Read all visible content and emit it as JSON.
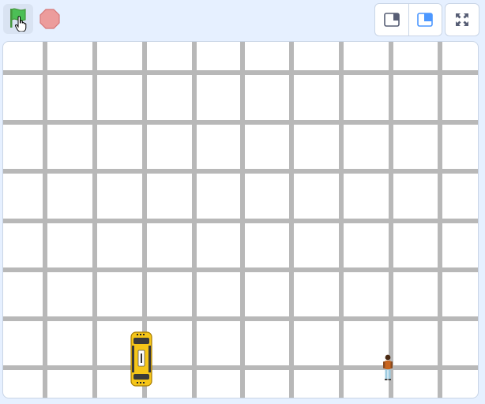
{
  "toolbar": {
    "green_flag": {
      "icon": "green-flag-icon",
      "color": "#4cbf56",
      "active": true
    },
    "stop": {
      "icon": "stop-sign-icon",
      "color": "#ec9c9c"
    },
    "layout_small_stage": {
      "icon": "small-stage-layout-icon"
    },
    "layout_normal_stage": {
      "icon": "normal-stage-layout-icon",
      "selected": true,
      "accent": "#4c97ff"
    },
    "fullscreen": {
      "icon": "fullscreen-icon"
    }
  },
  "stage": {
    "background_color": "#ffffff",
    "grid_color": "#b8b8b8",
    "sprites": [
      {
        "name": "taxi",
        "icon": "taxi-sprite",
        "color": "#f5c518"
      },
      {
        "name": "pedestrian",
        "icon": "person-sprite",
        "color": "#c8641e"
      }
    ]
  }
}
